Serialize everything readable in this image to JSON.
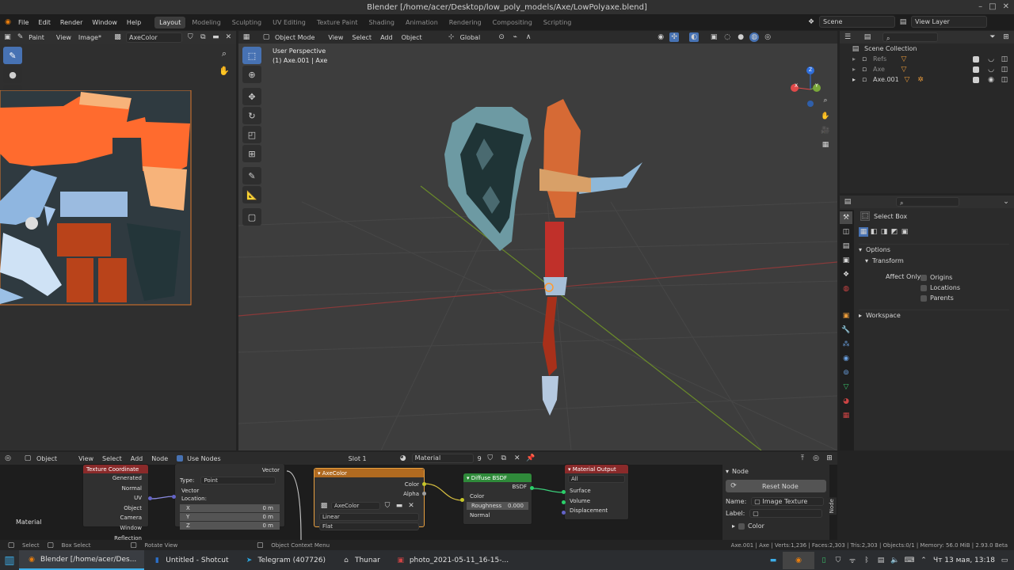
{
  "window": {
    "title": "Blender [/home/acer/Desktop/low_poly_models/Axe/LowPolyaxe.blend]",
    "controls": [
      "–",
      "□",
      "✕"
    ]
  },
  "menu": {
    "items": [
      "File",
      "Edit",
      "Render",
      "Window",
      "Help"
    ]
  },
  "workspaces": [
    "Layout",
    "Modeling",
    "Sculpting",
    "UV Editing",
    "Texture Paint",
    "Shading",
    "Animation",
    "Rendering",
    "Compositing",
    "Scripting"
  ],
  "scene": {
    "name": "Scene",
    "view_layer": "View Layer"
  },
  "image_editor": {
    "mode": "Paint",
    "view": "View",
    "image_menu": "Image*",
    "image_name": "AxeColor"
  },
  "viewport": {
    "mode": "Object Mode",
    "menus": [
      "View",
      "Select",
      "Add",
      "Object"
    ],
    "transform_orientation": "Global",
    "info_line1": "User Perspective",
    "info_line2": "(1) Axe.001 | Axe",
    "axes": [
      "X",
      "Y",
      "Z"
    ]
  },
  "outliner": {
    "root": "Scene Collection",
    "items": [
      {
        "name": "Refs",
        "dim": true
      },
      {
        "name": "Axe",
        "dim": true
      },
      {
        "name": "Axe.001",
        "dim": false
      }
    ]
  },
  "properties": {
    "tool": "Select Box",
    "options_label": "Options",
    "transform_label": "Transform",
    "affect_only": "Affect Only",
    "checks": [
      "Origins",
      "Locations",
      "Parents"
    ],
    "workspace_label": "Workspace"
  },
  "node_editor": {
    "type": "Object",
    "menus": [
      "View",
      "Select",
      "Add",
      "Node"
    ],
    "use_nodes": "Use Nodes",
    "slot": "Slot 1",
    "material": "Material",
    "users": "9",
    "material_label": "Material",
    "texcoord": {
      "title": "Texture Coordinate",
      "outputs": [
        "Generated",
        "Normal",
        "UV",
        "Object",
        "Camera",
        "Window",
        "Reflection"
      ]
    },
    "mapping": {
      "vector_out": "Vector",
      "type_label": "Type:",
      "type_value": "Point",
      "vector_in": "Vector",
      "location": "Location:",
      "x": "X",
      "y": "Y",
      "z": "Z",
      "xv": "0 m",
      "yv": "0 m",
      "zv": "0 m"
    },
    "imgtex": {
      "title": "AxeColor",
      "color": "Color",
      "alpha": "Alpha",
      "image": "AxeColor",
      "interp": "Linear",
      "proj": "Flat"
    },
    "bsdf": {
      "title": "Diffuse BSDF",
      "out": "BSDF",
      "color": "Color",
      "roughness": "Roughness",
      "roughness_val": "0.000",
      "normal": "Normal"
    },
    "output": {
      "title": "Material Output",
      "target": "All",
      "surface": "Surface",
      "volume": "Volume",
      "displacement": "Displacement"
    },
    "side": {
      "title": "Node",
      "reset": "Reset Node",
      "name_label": "Name:",
      "name_value": "Image Texture",
      "label_label": "Label:",
      "color": "Color",
      "tab": "Node"
    }
  },
  "status": {
    "left": [
      "Select",
      "Box Select",
      "Rotate View",
      "Object Context Menu"
    ],
    "right": "Axe.001 | Axe | Verts:1,236 | Faces:2,303 | Tris:2,303 | Objects:0/1 | Memory: 56.0 MiB | 2.93.0 Beta"
  },
  "taskbar": {
    "items": [
      "Blender [/home/acer/Des...",
      "Untitled - Shotcut",
      "Telegram (407726)",
      "Thunar",
      "photo_2021-05-11_16-15-..."
    ],
    "clock": "Чт 13 мая, 13:18"
  },
  "colors": {
    "accent": "#4772b3",
    "uv_orange": "#ff6b2e",
    "handle_red": "#c03020"
  }
}
